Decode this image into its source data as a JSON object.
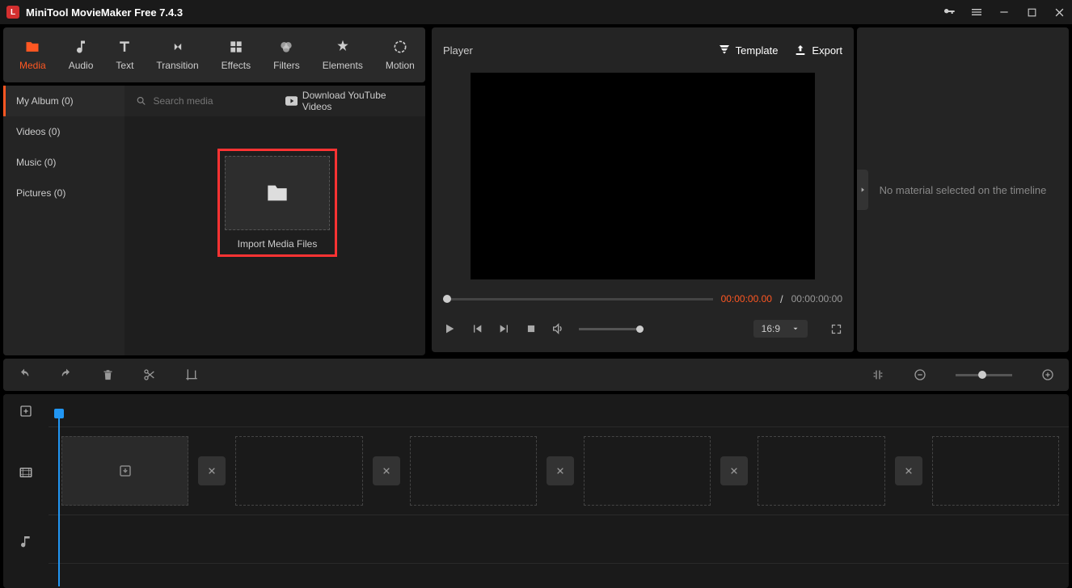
{
  "app": {
    "title": "MiniTool MovieMaker Free 7.4.3"
  },
  "tabs": [
    {
      "label": "Media",
      "icon": "folder"
    },
    {
      "label": "Audio",
      "icon": "music"
    },
    {
      "label": "Text",
      "icon": "text"
    },
    {
      "label": "Transition",
      "icon": "transition"
    },
    {
      "label": "Effects",
      "icon": "effects"
    },
    {
      "label": "Filters",
      "icon": "filters"
    },
    {
      "label": "Elements",
      "icon": "elements"
    },
    {
      "label": "Motion",
      "icon": "motion"
    }
  ],
  "sidebar": [
    {
      "label": "My Album (0)"
    },
    {
      "label": "Videos (0)"
    },
    {
      "label": "Music (0)"
    },
    {
      "label": "Pictures (0)"
    }
  ],
  "search": {
    "placeholder": "Search media"
  },
  "youtube": {
    "label": "Download YouTube Videos"
  },
  "import": {
    "label": "Import Media Files"
  },
  "player": {
    "title": "Player",
    "template_label": "Template",
    "export_label": "Export",
    "time_current": "00:00:00.00",
    "time_sep": " / ",
    "time_total": "00:00:00:00",
    "aspect": "16:9"
  },
  "right": {
    "empty": "No material selected on the timeline"
  }
}
